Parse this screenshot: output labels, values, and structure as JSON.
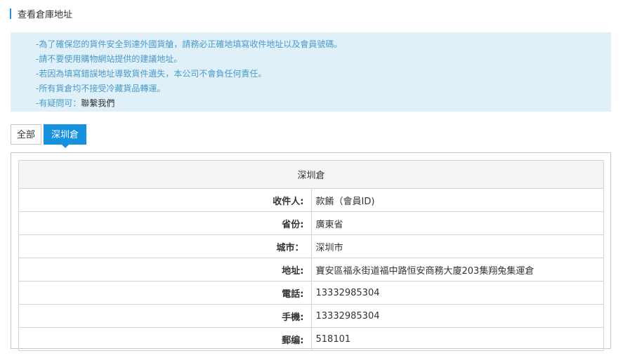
{
  "page": {
    "title": "查看倉庫地址"
  },
  "notice": {
    "lines": [
      "-為了確保您的貨件安全到達外國貨艙，請務必正確地填寫收件地址以及會員號碼。",
      "-請不要使用購物網站提供的建議地址。",
      "-若因為填寫錯誤地址導致貨件遺失，本公司不會負任何責任。",
      "-所有貨倉均不接受冷藏貨品轉運。"
    ],
    "contact_prefix": "-有疑問可：",
    "contact_link": "聯繫我們"
  },
  "tabs": [
    {
      "label": "全部",
      "active": false
    },
    {
      "label": "深圳倉",
      "active": true
    }
  ],
  "warehouse": {
    "name": "深圳倉",
    "rows": [
      {
        "label": "收件人:",
        "value": "款餚（會員ID)"
      },
      {
        "label": "省份:",
        "value": "廣東省"
      },
      {
        "label": "城市：",
        "value": "深圳市"
      },
      {
        "label": "地址:",
        "value": "寶安區福永街道福中路恒安商務大廈203集翔兔集運倉"
      },
      {
        "label": "電話:",
        "value": "13332985304"
      },
      {
        "label": "手機:",
        "value": "13332985304"
      },
      {
        "label": "郵编:",
        "value": "518101"
      }
    ]
  },
  "colors": {
    "accent": "#1591e0",
    "notice_bg": "#dff0f8",
    "notice_text": "#4a9ac8"
  }
}
